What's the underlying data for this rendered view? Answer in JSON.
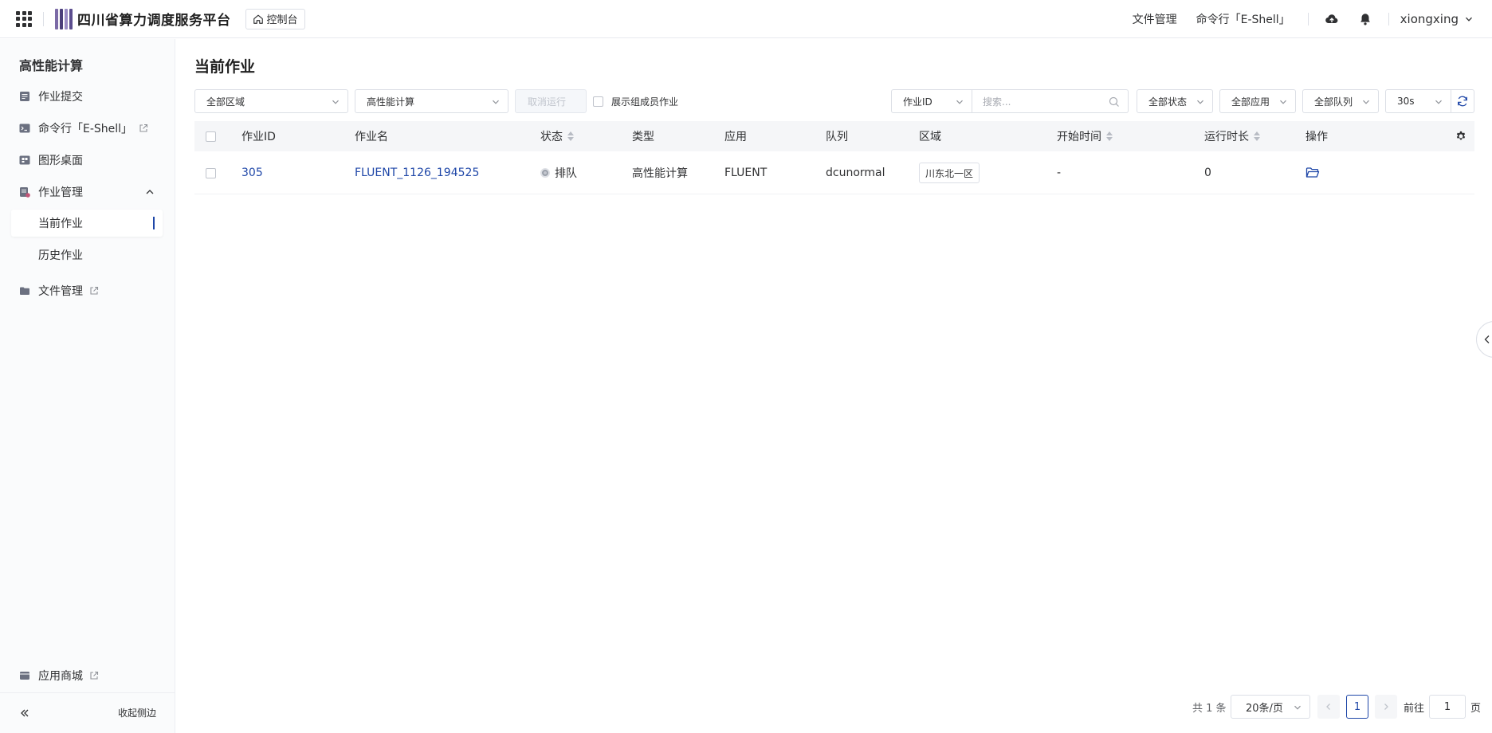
{
  "header": {
    "brand": "四川省算力调度服务平台",
    "console_label": "控制台",
    "links": {
      "file_manager": "文件管理",
      "eshell": "命令行「E-Shell」"
    },
    "user": "xiongxing"
  },
  "sidebar": {
    "title": "高性能计算",
    "items": {
      "submit": "作业提交",
      "eshell": "命令行「E-Shell」",
      "desktop": "图形桌面",
      "job_mgmt": "作业管理",
      "current_jobs": "当前作业",
      "history_jobs": "历史作业",
      "file_mgmt": "文件管理",
      "app_store": "应用商城"
    },
    "collapse_label": "收起侧边"
  },
  "main": {
    "title": "当前作业",
    "filters": {
      "region": "全部区域",
      "category": "高性能计算",
      "cancel_run": "取消运行",
      "show_members": "展示组成员作业",
      "search_field": "作业ID",
      "search_placeholder": "搜索...",
      "status": "全部状态",
      "app": "全部应用",
      "queue": "全部队列",
      "refresh_interval": "30s"
    },
    "columns": {
      "id": "作业ID",
      "name": "作业名",
      "status": "状态",
      "type": "类型",
      "app": "应用",
      "queue": "队列",
      "region": "区域",
      "start_time": "开始时间",
      "duration": "运行时长",
      "actions": "操作"
    },
    "rows": [
      {
        "id": "305",
        "name": "FLUENT_1126_194525",
        "status": "排队",
        "type": "高性能计算",
        "app": "FLUENT",
        "queue": "dcunormal",
        "region": "川东北一区",
        "start_time": "-",
        "duration": "0"
      }
    ],
    "pagination": {
      "total": "共 1 条",
      "page_size": "20条/页",
      "current": "1",
      "goto_label": "前往",
      "goto_value": "1",
      "page_suffix": "页"
    }
  },
  "colors": {
    "accent": "#1f47a8",
    "border": "#dcdfe6",
    "header_bg": "#f5f6f8"
  }
}
